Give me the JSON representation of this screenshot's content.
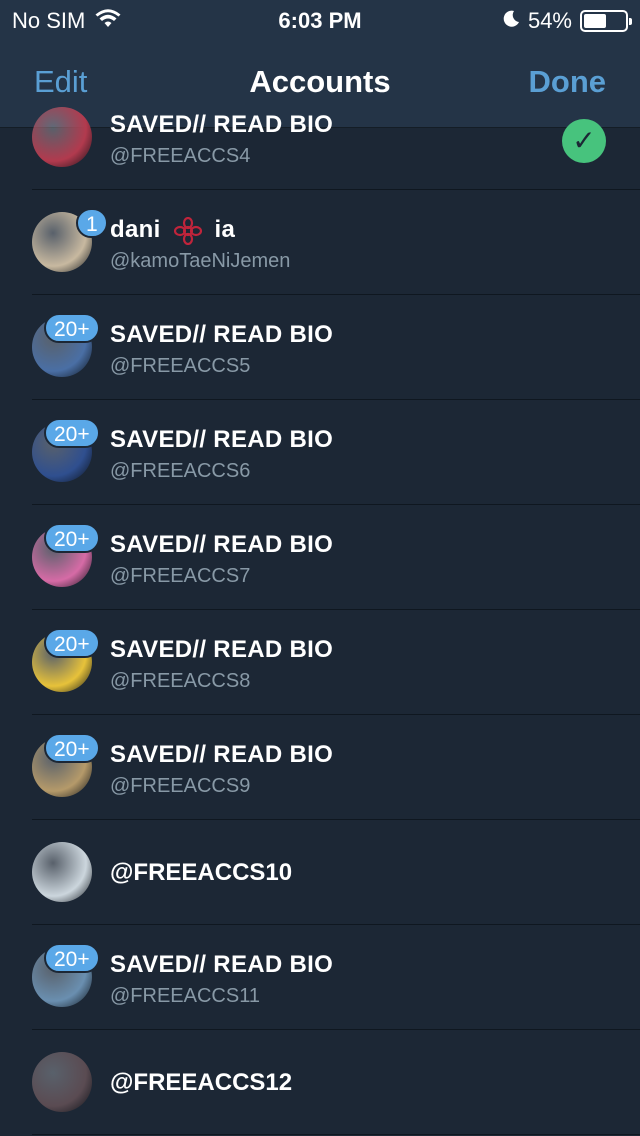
{
  "status": {
    "carrier": "No SIM",
    "time": "6:03 PM",
    "battery_text": "54%",
    "battery_level": 0.54
  },
  "nav": {
    "edit_label": "Edit",
    "title": "Accounts",
    "done_label": "Done"
  },
  "accounts": [
    {
      "name": "SAVED// READ BIO",
      "handle": "@FREEACCS4",
      "badge": "",
      "selected": true,
      "avatar_color": "#b23a4e"
    },
    {
      "name_part1": "dani",
      "name_part2": "ia",
      "handle": "@kamoTaeNiJemen",
      "badge": "1",
      "avatar_color": "#c8b9a0"
    },
    {
      "name": "SAVED// READ BIO",
      "handle": "@FREEACCS5",
      "badge": "20+",
      "avatar_color": "#4a6fa5"
    },
    {
      "name": "SAVED// READ BIO",
      "handle": "@FREEACCS6",
      "badge": "20+",
      "avatar_color": "#2f4f8f"
    },
    {
      "name": "SAVED// READ BIO",
      "handle": "@FREEACCS7",
      "badge": "20+",
      "avatar_color": "#d66ba6"
    },
    {
      "name": "SAVED// READ BIO",
      "handle": "@FREEACCS8",
      "badge": "20+",
      "avatar_color": "#e7c23a"
    },
    {
      "name": "SAVED// READ BIO",
      "handle": "@FREEACCS9",
      "badge": "20+",
      "avatar_color": "#b59a6a"
    },
    {
      "single": "@FREEACCS10",
      "badge": "",
      "avatar_color": "#ccd6dd"
    },
    {
      "name": "SAVED// READ BIO",
      "handle": "@FREEACCS11",
      "badge": "20+",
      "avatar_color": "#6a8fb0"
    },
    {
      "single": "@FREEACCS12",
      "badge": "",
      "avatar_color": "#5a4b52"
    }
  ]
}
